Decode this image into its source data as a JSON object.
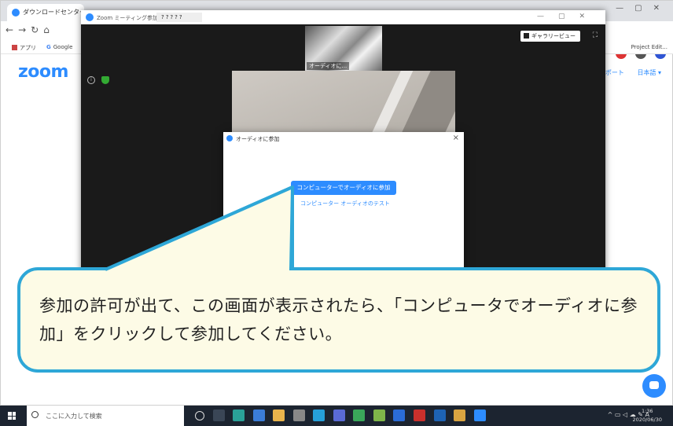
{
  "browser": {
    "tabs": [
      {
        "label": "ダウンロードセンター - Zo"
      }
    ],
    "bookmarks": {
      "apps": "アプリ",
      "google": "Google",
      "project": "Project Edit..."
    },
    "site_nav": {
      "support": "サポート",
      "language": "日本語 ▾"
    },
    "logo": "zoom"
  },
  "zoom_window": {
    "title": "Zoom ミーティング参加者ID：",
    "meeting_id": "?????",
    "gallery_button": "ギャラリービュー",
    "thumbnail_name": "オーディオに...",
    "info_icon_label": "i"
  },
  "dialog": {
    "title": "オーディオに参加",
    "join_button": "コンピューターでオーディオに参加",
    "test_link": "コンピューター オーディオのテスト",
    "close": "×"
  },
  "callout": {
    "text": "参加の許可が出て、この画面が表示されたら、「コンピュータでオーディオに参加」をクリックして参加してください。"
  },
  "taskbar": {
    "search_placeholder": "ここに入力して検索",
    "time": "1:36",
    "date": "2020/06/30",
    "ime": "A"
  },
  "colors": {
    "zoom_blue": "#2d8cff",
    "callout_border": "#2ea7d7",
    "callout_fill": "#fdfbe6"
  }
}
